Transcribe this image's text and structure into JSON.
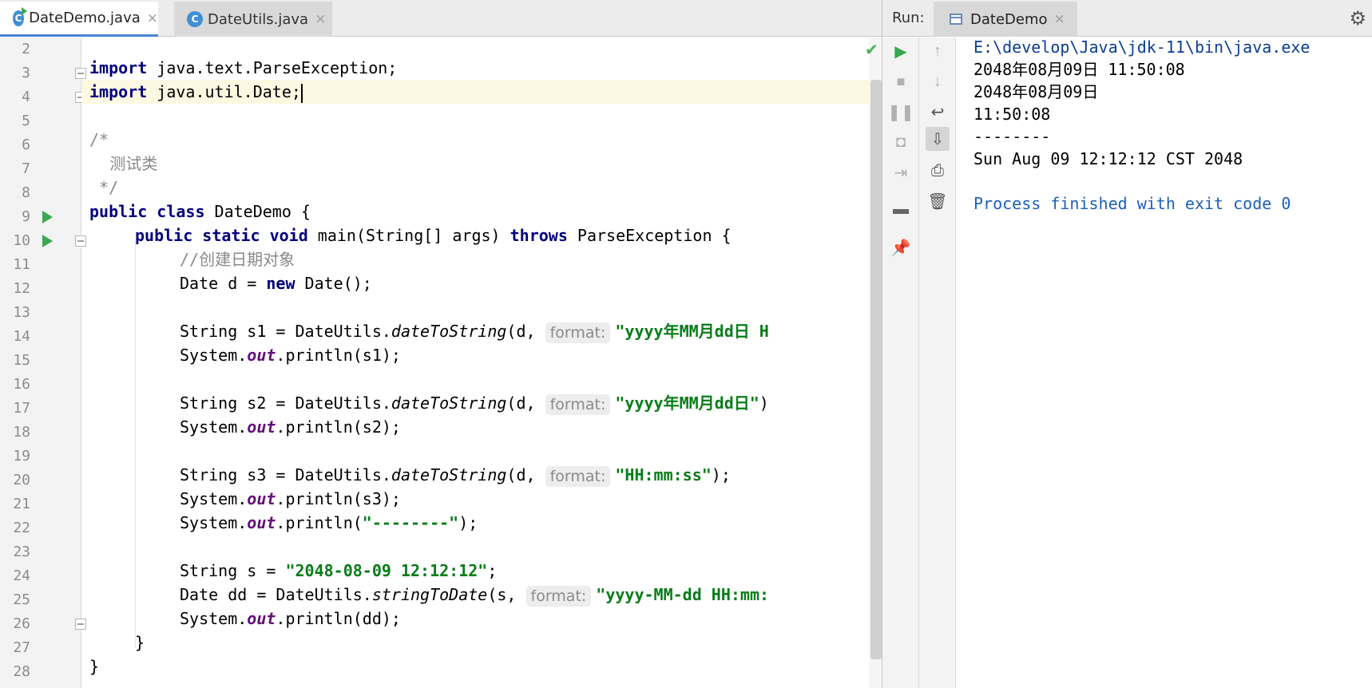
{
  "editor": {
    "tabs": [
      {
        "label": "DateDemo.java",
        "close": "×",
        "icon_letter": "C"
      },
      {
        "label": "DateUtils.java",
        "close": "×",
        "icon_letter": "C"
      }
    ],
    "line_numbers": [
      "2",
      "3",
      "4",
      "5",
      "6",
      "7",
      "8",
      "9",
      "10",
      "11",
      "12",
      "13",
      "14",
      "15",
      "16",
      "17",
      "18",
      "19",
      "20",
      "21",
      "22",
      "23",
      "24",
      "25",
      "26",
      "27",
      "28"
    ],
    "code": {
      "l3": {
        "kw": "import",
        "rest": " java.text.ParseException;"
      },
      "l4": {
        "kw": "import",
        "rest": " java.util.Date;"
      },
      "l6": "/*",
      "l7": "    测试类",
      "l8": " */",
      "l9": {
        "kw": "public class",
        "rest": " DateDemo {"
      },
      "l10": {
        "kw1": "public static void",
        "mid": " main(String[] args) ",
        "kw2": "throws",
        "rest": " ParseException {"
      },
      "l11": "//创建日期对象",
      "l12": {
        "pre": "Date d = ",
        "kw": "new",
        "rest": " Date();"
      },
      "l14": {
        "pre": "String s1 = DateUtils.",
        "method": "dateToString",
        "args": "(d, ",
        "hint": "format:",
        "str": "\"yyyy年MM月dd日 H"
      },
      "l15": {
        "pre": "System.",
        "fld": "out",
        "rest": ".println(s1);"
      },
      "l17": {
        "pre": "String s2 = DateUtils.",
        "method": "dateToString",
        "args": "(d, ",
        "hint": "format:",
        "str": "\"yyyy年MM月dd日\"",
        "rest": ")"
      },
      "l18": {
        "pre": "System.",
        "fld": "out",
        "rest": ".println(s2);"
      },
      "l20": {
        "pre": "String s3 = DateUtils.",
        "method": "dateToString",
        "args": "(d, ",
        "hint": "format:",
        "str": "\"HH:mm:ss\"",
        "rest": ");"
      },
      "l21": {
        "pre": "System.",
        "fld": "out",
        "rest": ".println(s3);"
      },
      "l22": {
        "pre": "System.",
        "fld": "out",
        "mid": ".println(",
        "str": "\"--------\"",
        "rest": ");"
      },
      "l24": {
        "pre": "String s = ",
        "str": "\"2048-08-09 12:12:12\"",
        "rest": ";"
      },
      "l25": {
        "pre": "Date dd = DateUtils.",
        "method": "stringToDate",
        "args": "(s, ",
        "hint": "format:",
        "str": "\"yyyy-MM-dd HH:mm:"
      },
      "l26": {
        "pre": "System.",
        "fld": "out",
        "rest": ".println(dd);"
      },
      "l27": "}",
      "l28": "}"
    }
  },
  "run": {
    "title": "Run:",
    "tab_label": "DateDemo",
    "tab_close": "×",
    "console": [
      "E:\\develop\\Java\\jdk-11\\bin\\java.exe",
      "2048年08月09日 11:50:08",
      "2048年08月09日",
      "11:50:08",
      "--------",
      "Sun Aug 09 12:12:12 CST 2048",
      "",
      "Process finished with exit code 0"
    ]
  }
}
